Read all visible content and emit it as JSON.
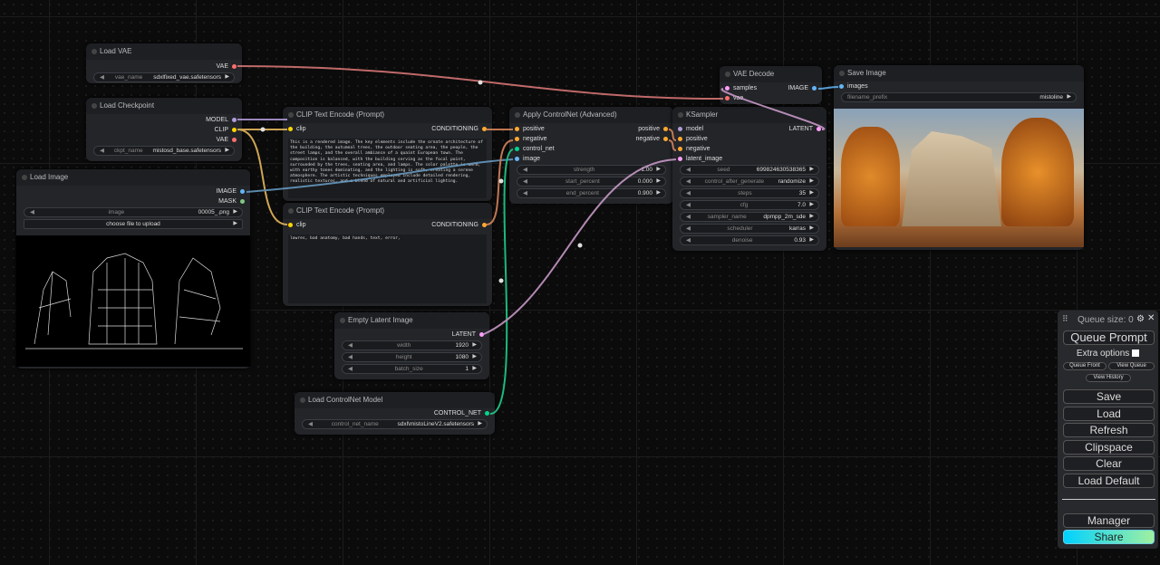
{
  "nodes": {
    "load_vae": {
      "title": "Load VAE",
      "out": "VAE",
      "widget": {
        "label": "vae_name",
        "value": "sdxlfixed_vae.safetensors"
      }
    },
    "load_checkpoint": {
      "title": "Load Checkpoint",
      "outs": [
        "MODEL",
        "CLIP",
        "VAE"
      ],
      "widget": {
        "label": "ckpt_name",
        "value": "mistosd_base.safetensors"
      }
    },
    "load_image": {
      "title": "Load Image",
      "outs": [
        "IMAGE",
        "MASK"
      ],
      "widget": {
        "label": "image",
        "value": "00005_.png"
      },
      "upload": "choose file to upload"
    },
    "clip_pos": {
      "title": "CLIP Text Encode (Prompt)",
      "in": "clip",
      "out": "CONDITIONING",
      "text": "This is a rendered image. The key elements include the ornate architecture of the building, the autumnal trees, the outdoor seating area, the people, the street lamps, and the overall ambiance of a quaint European town. The composition is balanced, with the building serving as the focal point, surrounded by the trees, seating area, and lamps. The color palette is warm, with earthy tones dominating, and the lighting is soft, creating a serene atmosphere. The artistic techniques employed include detailed rendering, realistic textures, and a blend of natural and artificial lighting."
    },
    "clip_neg": {
      "title": "CLIP Text Encode (Prompt)",
      "in": "clip",
      "out": "CONDITIONING",
      "text": "lowres, bad anatomy, bad hands, text, error,"
    },
    "apply_cn": {
      "title": "Apply ControlNet (Advanced)",
      "ins": [
        "positive",
        "negative",
        "control_net",
        "image"
      ],
      "outs": [
        "positive",
        "negative"
      ],
      "widgets": [
        {
          "label": "strength",
          "value": "1.00"
        },
        {
          "label": "start_percent",
          "value": "0.000"
        },
        {
          "label": "end_percent",
          "value": "0.900"
        }
      ]
    },
    "ksampler": {
      "title": "KSampler",
      "ins": [
        "model",
        "positive",
        "negative",
        "latent_image"
      ],
      "out": "LATENT",
      "widgets": [
        {
          "label": "seed",
          "value": "699824630538365"
        },
        {
          "label": "control_after_generate",
          "value": "randomize"
        },
        {
          "label": "steps",
          "value": "35"
        },
        {
          "label": "cfg",
          "value": "7.0"
        },
        {
          "label": "sampler_name",
          "value": "dpmpp_2m_sde"
        },
        {
          "label": "scheduler",
          "value": "karras"
        },
        {
          "label": "denoise",
          "value": "0.93"
        }
      ]
    },
    "vae_decode": {
      "title": "VAE Decode",
      "ins": [
        "samples",
        "vae"
      ],
      "out": "IMAGE"
    },
    "save_image": {
      "title": "Save Image",
      "in": "images",
      "widget": {
        "label": "filename_prefix",
        "value": "mistoline"
      }
    },
    "empty_latent": {
      "title": "Empty Latent Image",
      "out": "LATENT",
      "widgets": [
        {
          "label": "width",
          "value": "1920"
        },
        {
          "label": "height",
          "value": "1080"
        },
        {
          "label": "batch_size",
          "value": "1"
        }
      ]
    },
    "load_cn": {
      "title": "Load ControlNet Model",
      "out": "CONTROL_NET",
      "widget": {
        "label": "control_net_name",
        "value": "sdxl\\mistoLineV2.safetensors"
      }
    }
  },
  "menu": {
    "queue_size": "Queue size: 0",
    "queue_prompt": "Queue Prompt",
    "extra_options": "Extra options",
    "queue_front": "Queue Front",
    "view_queue": "View Queue",
    "view_history": "View History",
    "save": "Save",
    "load": "Load",
    "refresh": "Refresh",
    "clipspace": "Clipspace",
    "clear": "Clear",
    "load_default": "Load Default",
    "manager": "Manager",
    "share": "Share"
  },
  "colors": {
    "vae": "#ff6e6e",
    "clip": "#ffd500",
    "model": "#b39ddb",
    "conditioning": "#ffa931",
    "latent": "#ff9cf9",
    "image": "#64b5f6",
    "control_net": "#00d78d"
  }
}
